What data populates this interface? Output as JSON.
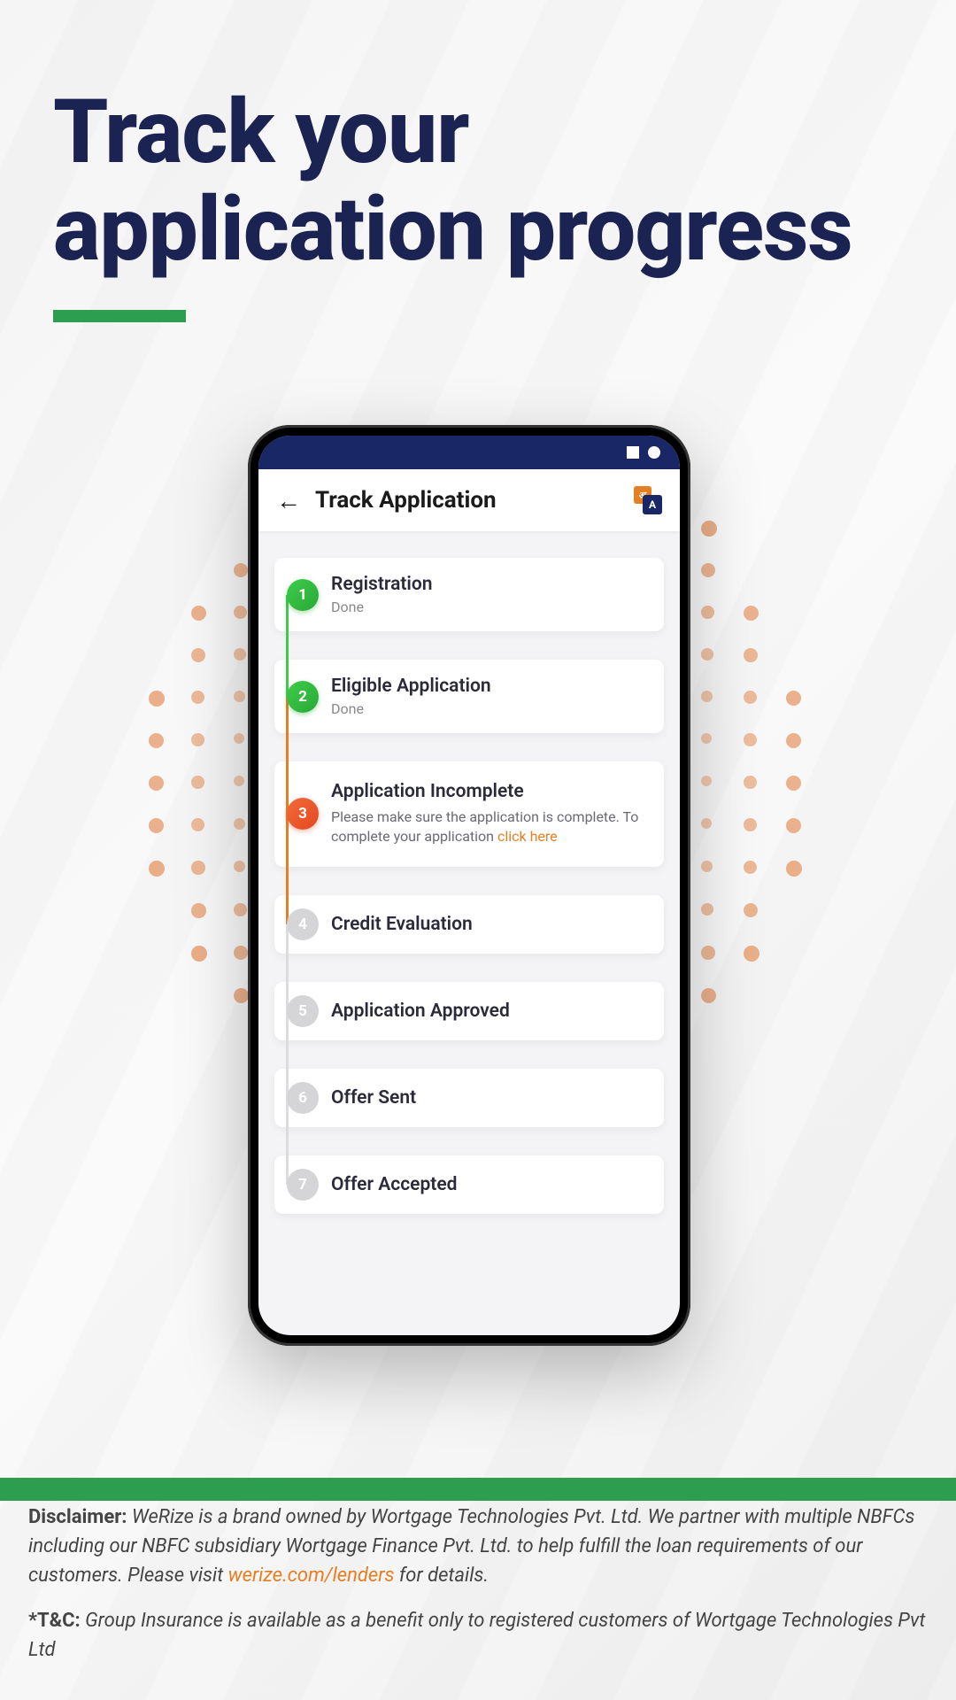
{
  "headline_line1": "Track your",
  "headline_line2": "application progress",
  "app": {
    "header_title": "Track Application"
  },
  "steps": [
    {
      "num": "1",
      "title": "Registration",
      "sub": "Done",
      "state": "done"
    },
    {
      "num": "2",
      "title": "Eligible Application",
      "sub": "Done",
      "state": "done"
    },
    {
      "num": "3",
      "title": "Application Incomplete",
      "desc_before": "Please make sure the application is complete. To complete your application ",
      "desc_link": "click here",
      "state": "current"
    },
    {
      "num": "4",
      "title": "Credit Evaluation",
      "state": "pending"
    },
    {
      "num": "5",
      "title": "Application Approved",
      "state": "pending"
    },
    {
      "num": "6",
      "title": "Offer Sent",
      "state": "pending"
    },
    {
      "num": "7",
      "title": "Offer Accepted",
      "state": "pending"
    }
  ],
  "disclaimer": {
    "label": "Disclaimer:",
    "text_before": " WeRize is a brand owned by Wortgage Technologies Pvt. Ltd. We partner with multiple NBFCs including our NBFC subsidiary Wortgage Finance Pvt. Ltd. to help fulfill the loan requirements of our customers. Please visit ",
    "link": "werize.com/lenders",
    "text_after": " for details.",
    "tc_label": "*T&C:",
    "tc_text": " Group Insurance is available as a benefit only to registered customers of Wortgage Technologies Pvt Ltd"
  }
}
